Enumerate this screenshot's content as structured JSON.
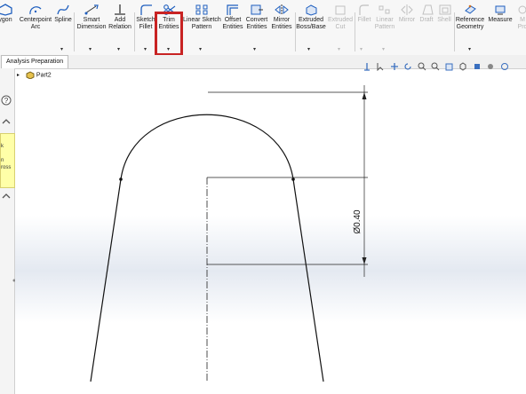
{
  "ribbon": {
    "tools": [
      {
        "id": "polygon",
        "label": "ygon",
        "disabled": false,
        "icon": "polygon-icon"
      },
      {
        "id": "centerpoint-arc",
        "label": "Centerpoint\nArc",
        "disabled": false,
        "icon": "arc-icon"
      },
      {
        "id": "spline",
        "label": "Spline",
        "disabled": false,
        "icon": "spline-icon"
      },
      {
        "id": "smart-dimension",
        "label": "Smart\nDimension",
        "disabled": false,
        "icon": "smart-dimension-icon"
      },
      {
        "id": "add-relation",
        "label": "Add\nRelation",
        "disabled": false,
        "icon": "relation-icon"
      },
      {
        "id": "sketch-fillet",
        "label": "Sketch\nFillet",
        "disabled": false,
        "icon": "fillet-icon"
      },
      {
        "id": "trim-entities",
        "label": "Trim\nEntities",
        "disabled": false,
        "icon": "trim-icon"
      },
      {
        "id": "linear-sketch-pattern",
        "label": "Linear Sketch\nPattern",
        "disabled": false,
        "icon": "pattern-icon"
      },
      {
        "id": "offset-entities",
        "label": "Offset\nEntities",
        "disabled": false,
        "icon": "offset-icon"
      },
      {
        "id": "convert-entities",
        "label": "Convert\nEntities",
        "disabled": false,
        "icon": "convert-icon"
      },
      {
        "id": "mirror-entities",
        "label": "Mirror\nEntities",
        "disabled": false,
        "icon": "mirror-icon"
      },
      {
        "id": "extruded-boss",
        "label": "Extruded\nBoss/Base",
        "disabled": false,
        "icon": "extrude-icon"
      },
      {
        "id": "extruded-cut",
        "label": "Extruded\nCut",
        "disabled": true,
        "icon": "cut-icon"
      },
      {
        "id": "fillet",
        "label": "Fillet",
        "disabled": true,
        "icon": "feature-fillet-icon"
      },
      {
        "id": "linear-pattern",
        "label": "Linear\nPattern",
        "disabled": true,
        "icon": "linear-pattern-icon"
      },
      {
        "id": "mirror",
        "label": "Mirror",
        "disabled": true,
        "icon": "mirror-feature-icon"
      },
      {
        "id": "draft",
        "label": "Draft",
        "disabled": true,
        "icon": "draft-icon"
      },
      {
        "id": "shell",
        "label": "Shell",
        "disabled": true,
        "icon": "shell-icon"
      },
      {
        "id": "reference-geometry",
        "label": "Reference\nGeometry",
        "disabled": false,
        "icon": "reference-geometry-icon"
      },
      {
        "id": "measure",
        "label": "Measure",
        "disabled": false,
        "icon": "measure-icon"
      },
      {
        "id": "mass-properties",
        "label": "M\nPro",
        "disabled": true,
        "icon": "mass-properties-icon"
      }
    ]
  },
  "tabs": {
    "active": "Analysis Preparation"
  },
  "tree": {
    "root": "Part2"
  },
  "panel": {
    "note_lines": [
      "k",
      "n",
      "ross"
    ]
  },
  "sketch": {
    "dimension": "Ø0.40"
  },
  "colors": {
    "highlight": "#c82323",
    "note": "#ffffa8",
    "accent": "#1f5fbf"
  }
}
